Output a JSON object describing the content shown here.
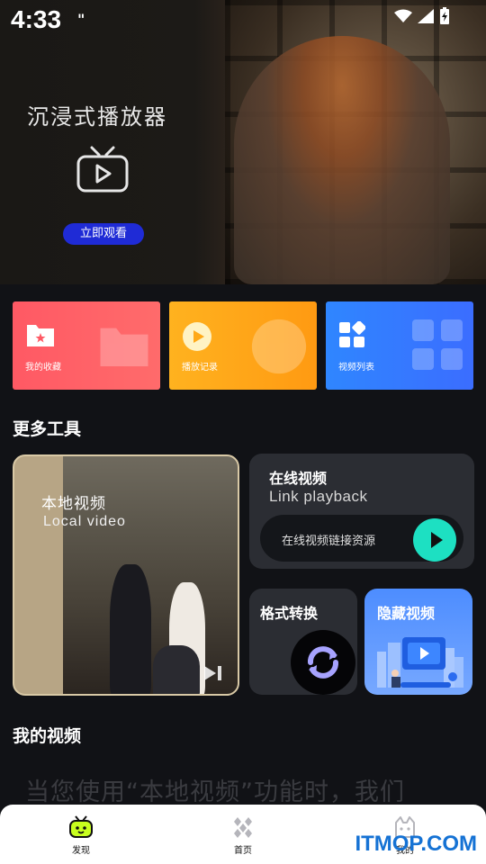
{
  "status_bar": {
    "time": "4:33",
    "sim": "\""
  },
  "hero": {
    "title": "沉浸式播放器",
    "button": "立即观看",
    "icon": "tv-play-icon"
  },
  "quick_cards": [
    {
      "label": "我的收藏",
      "icon": "folder-star-icon",
      "color": "#ff5f66"
    },
    {
      "label": "播放记录",
      "icon": "play-circle-icon",
      "color": "#ffa918"
    },
    {
      "label": "视频列表",
      "icon": "grid-list-icon",
      "color": "#357aff"
    }
  ],
  "more_tools": {
    "title": "更多工具",
    "local_video": {
      "title": "本地视频",
      "subtitle": "Local video"
    },
    "online_video": {
      "title": "在线视频",
      "subtitle": "Link playback",
      "pill_text": "在线视频链接资源"
    },
    "format_convert": {
      "title": "格式转换"
    },
    "hidden_video": {
      "title": "隐藏视频"
    }
  },
  "my_videos": {
    "title": "我的视频",
    "intro": "当您使用“本地视频”功能时，我们"
  },
  "tabbar": [
    {
      "label": "发现",
      "icon": "tv-face-icon",
      "active": true
    },
    {
      "label": "首页",
      "icon": "diamond-cluster-icon",
      "active": false
    },
    {
      "label": "我的",
      "icon": "cat-face-icon",
      "active": false
    }
  ],
  "watermark": "ITMOP.COM"
}
